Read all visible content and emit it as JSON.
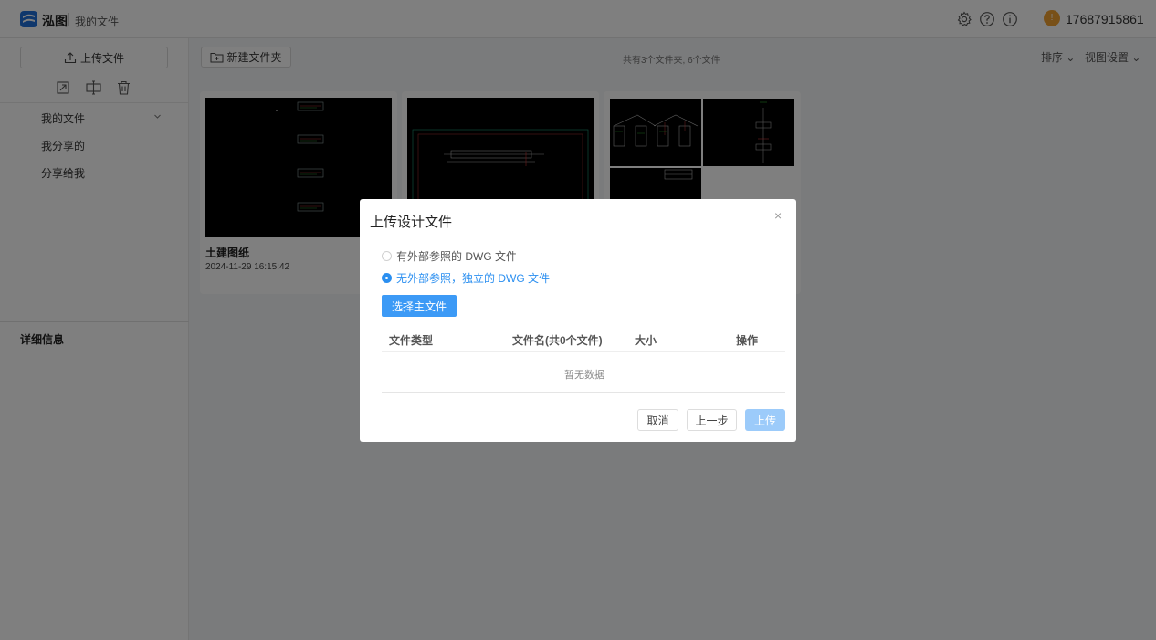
{
  "header": {
    "brand": "泓图",
    "breadcrumb": "我的文件",
    "user_initial": "!",
    "user_phone": "17687915861"
  },
  "sidebar": {
    "upload_label": "上传文件",
    "items": [
      {
        "label": "我的文件"
      },
      {
        "label": "我分享的"
      },
      {
        "label": "分享给我"
      }
    ],
    "details_label": "详细信息"
  },
  "toolbar": {
    "new_folder_label": "新建文件夹",
    "summary": "共有3个文件夹, 6个文件",
    "sort_label": "排序",
    "view_settings_label": "视图设置"
  },
  "cards": [
    {
      "name": "土建图纸",
      "time": "2024-11-29 16:15:42"
    }
  ],
  "dialog": {
    "title": "上传设计文件",
    "close": "×",
    "options": [
      {
        "label": "有外部参照的 DWG 文件",
        "selected": false
      },
      {
        "label": "无外部参照，独立的 DWG 文件",
        "selected": true
      }
    ],
    "choose_label": "选择主文件",
    "columns": [
      "文件类型",
      "文件名(共0个文件)",
      "大小",
      "操作"
    ],
    "empty_text": "暂无数据",
    "cancel_label": "取消",
    "prev_label": "上一步",
    "upload_label": "上传"
  },
  "colors": {
    "accent": "#2b8ff0",
    "button_primary": "#3c9af6",
    "button_disabled": "#9ccbfa",
    "avatar": "#f0a030"
  }
}
